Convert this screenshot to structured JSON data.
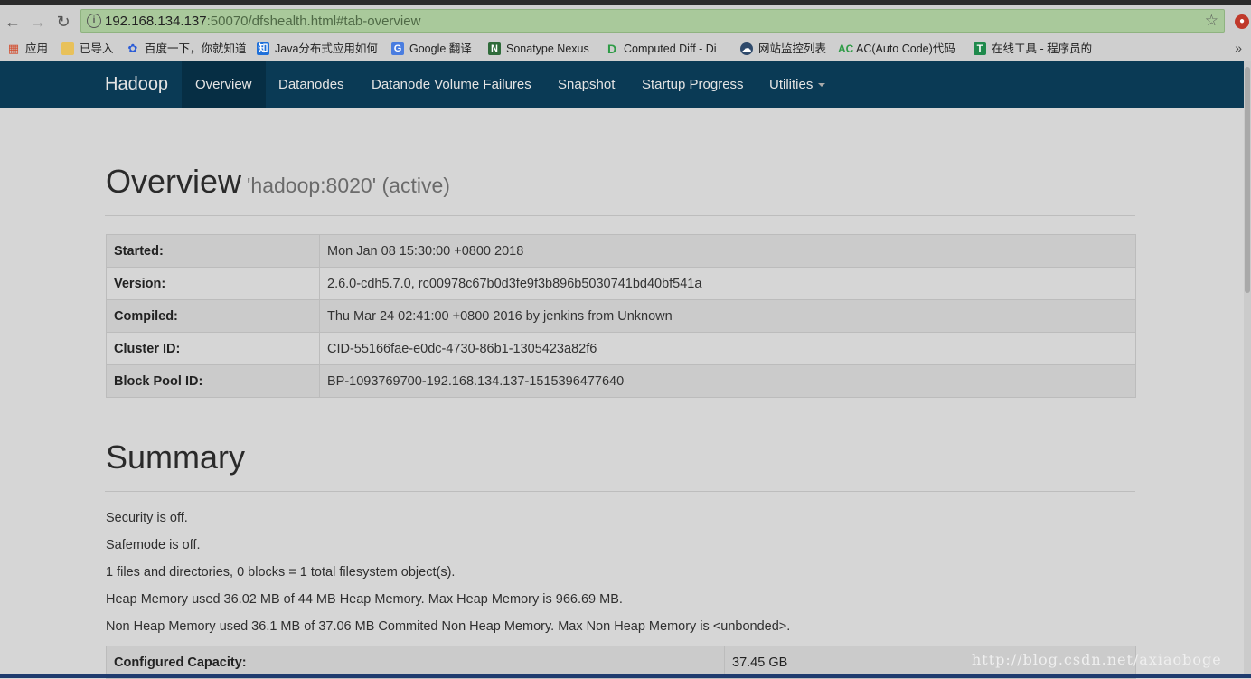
{
  "browser": {
    "url_host": "192.168.134.137",
    "url_rest": ":50070/dfshealth.html#tab-overview",
    "back_icon": "arrow-left-icon",
    "forward_icon": "arrow-right-icon",
    "reload_icon": "reload-icon",
    "info_icon": "i",
    "star_icon": "☆",
    "bookmarks": [
      {
        "label": "应用",
        "icon": "apps-grid-icon"
      },
      {
        "label": "已导入",
        "icon": "folder-icon"
      },
      {
        "label": "百度一下，你就知道",
        "icon": "baidu-paw-icon"
      },
      {
        "label": "Java分布式应用如何",
        "icon": "zhihu-icon"
      },
      {
        "label": "Google 翻译",
        "icon": "google-translate-icon"
      },
      {
        "label": "Sonatype Nexus",
        "icon": "nexus-icon"
      },
      {
        "label": "Computed Diff - Di",
        "icon": "diff-icon"
      },
      {
        "label": "网站监控列表",
        "icon": "monitor-icon"
      },
      {
        "label": "AC(Auto Code)代码",
        "icon": "ac-icon"
      },
      {
        "label": "在线工具 - 程序员的",
        "icon": "tools-icon"
      }
    ],
    "bookmarks_more": "»"
  },
  "navbar": {
    "brand": "Hadoop",
    "items": [
      {
        "label": "Overview",
        "active": true
      },
      {
        "label": "Datanodes",
        "active": false
      },
      {
        "label": "Datanode Volume Failures",
        "active": false
      },
      {
        "label": "Snapshot",
        "active": false
      },
      {
        "label": "Startup Progress",
        "active": false
      },
      {
        "label": "Utilities",
        "active": false,
        "dropdown": true
      }
    ]
  },
  "overview": {
    "title": "Overview",
    "subtitle": "'hadoop:8020' (active)",
    "rows": [
      {
        "key": "Started:",
        "value": "Mon Jan 08 15:30:00 +0800 2018"
      },
      {
        "key": "Version:",
        "value": "2.6.0-cdh5.7.0, rc00978c67b0d3fe9f3b896b5030741bd40bf541a"
      },
      {
        "key": "Compiled:",
        "value": "Thu Mar 24 02:41:00 +0800 2016 by jenkins from Unknown"
      },
      {
        "key": "Cluster ID:",
        "value": "CID-55166fae-e0dc-4730-86b1-1305423a82f6"
      },
      {
        "key": "Block Pool ID:",
        "value": "BP-1093769700-192.168.134.137-1515396477640"
      }
    ]
  },
  "summary": {
    "title": "Summary",
    "lines": [
      "Security is off.",
      "Safemode is off.",
      "1 files and directories, 0 blocks = 1 total filesystem object(s).",
      "Heap Memory used 36.02 MB of 44 MB Heap Memory. Max Heap Memory is 966.69 MB.",
      "Non Heap Memory used 36.1 MB of 37.06 MB Commited Non Heap Memory. Max Non Heap Memory is <unbonded>."
    ],
    "capacity_key": "Configured Capacity:",
    "capacity_value": "37.45 GB"
  },
  "watermark": "http://blog.csdn.net/axiaoboge",
  "colors": {
    "navbar": "#0a3a55",
    "navbar_active": "#062e44",
    "omnibox": "#a9c99b",
    "page_bg": "#d6d6d6"
  }
}
